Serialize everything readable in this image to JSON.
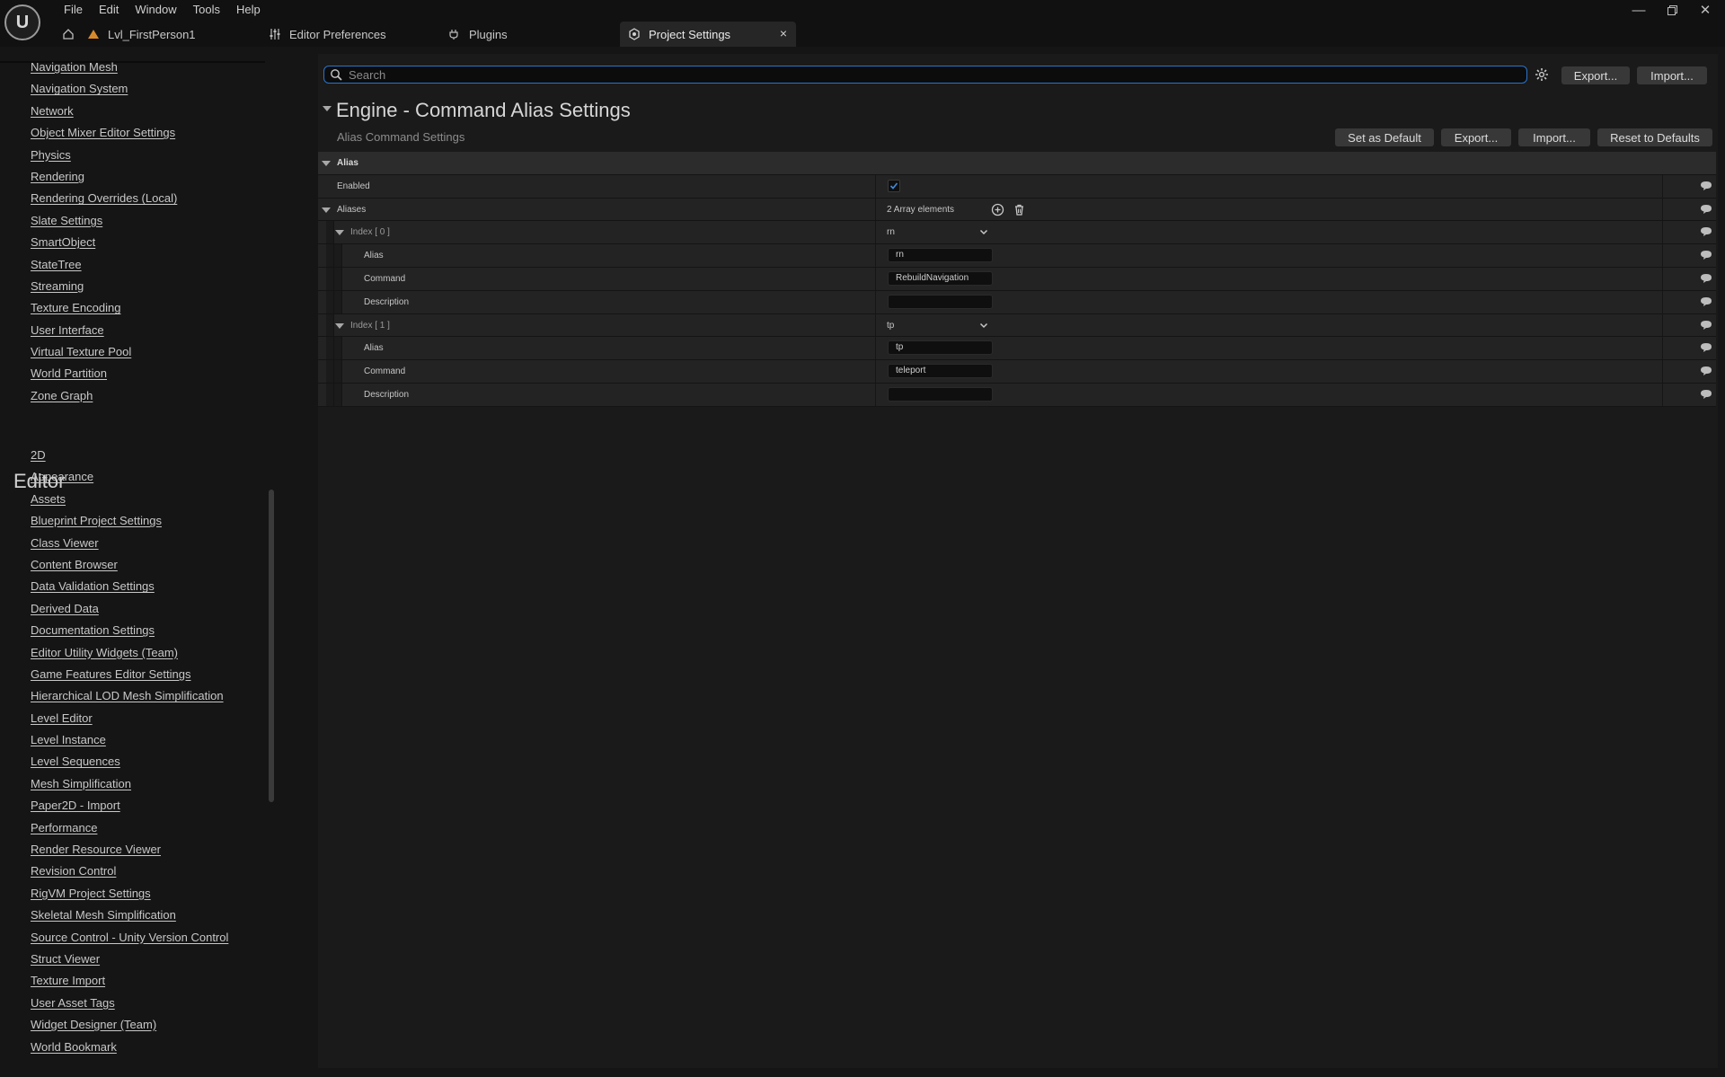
{
  "menu": [
    "File",
    "Edit",
    "Window",
    "Tools",
    "Help"
  ],
  "tabs": {
    "level": "Lvl_FirstPerson1",
    "editor_prefs": "Editor Preferences",
    "plugins": "Plugins",
    "project_settings": "Project Settings"
  },
  "sidebar": {
    "engine_items": [
      "Navigation Mesh",
      "Navigation System",
      "Network",
      "Object Mixer Editor Settings",
      "Physics",
      "Rendering",
      "Rendering Overrides (Local)",
      "Slate Settings",
      "SmartObject",
      "StateTree",
      "Streaming",
      "Texture Encoding",
      "User Interface",
      "Virtual Texture Pool",
      "World Partition",
      "Zone Graph"
    ],
    "editor_heading": "Editor",
    "editor_items": [
      "2D",
      "Appearance",
      "Assets",
      "Blueprint Project Settings",
      "Class Viewer",
      "Content Browser",
      "Data Validation Settings",
      "Derived Data",
      "Documentation Settings",
      "Editor Utility Widgets (Team)",
      "Game Features Editor Settings",
      "Hierarchical LOD Mesh Simplification",
      "Level Editor",
      "Level Instance",
      "Level Sequences",
      "Mesh Simplification",
      "Paper2D - Import",
      "Performance",
      "Render Resource Viewer",
      "Revision Control",
      "RigVM Project Settings",
      "Skeletal Mesh Simplification",
      "Source Control - Unity Version Control",
      "Struct Viewer",
      "Texture Import",
      "User Asset Tags",
      "Widget Designer (Team)",
      "World Bookmark"
    ]
  },
  "toolbar": {
    "search_placeholder": "Search",
    "export": "Export...",
    "import": "Import..."
  },
  "category": {
    "title": "Engine - Command Alias Settings",
    "subtitle": "Alias Command Settings",
    "set_default": "Set as Default",
    "export": "Export...",
    "import": "Import...",
    "reset": "Reset to Defaults"
  },
  "properties": {
    "section": "Alias",
    "enabled_label": "Enabled",
    "enabled_value": true,
    "aliases_label": "Aliases",
    "aliases_count": "2 Array elements",
    "elements": [
      {
        "index_label": "Index [ 0 ]",
        "combo": "rn",
        "alias_label": "Alias",
        "alias": "rn",
        "command_label": "Command",
        "command": "RebuildNavigation",
        "description_label": "Description",
        "description": ""
      },
      {
        "index_label": "Index [ 1 ]",
        "combo": "tp",
        "alias_label": "Alias",
        "alias": "tp",
        "command_label": "Command",
        "command": "teleport",
        "description_label": "Description",
        "description": ""
      }
    ]
  },
  "colors": {
    "accent": "#2b74c8",
    "background": "#151515",
    "panel": "#1a1a1a",
    "row": "#232323"
  }
}
